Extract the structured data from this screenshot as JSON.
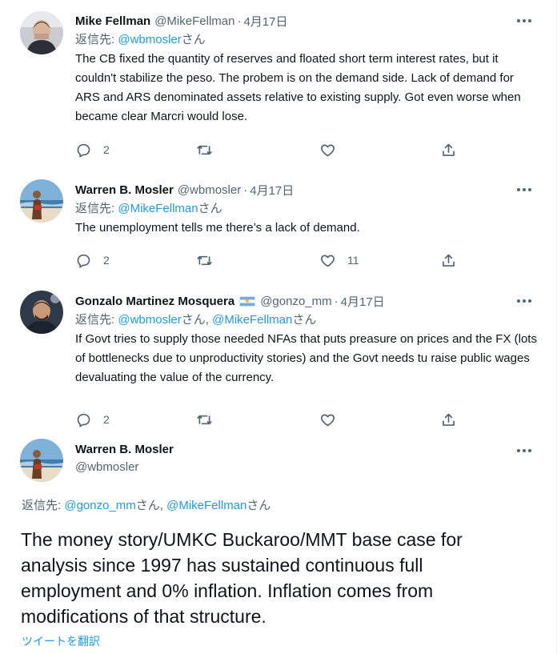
{
  "tweets": [
    {
      "name": "Mike Fellman",
      "handle": "@MikeFellman",
      "sep": "·",
      "date": "4月17日",
      "reply_prefix": "返信先: ",
      "reply_mention": "@wbmosler",
      "reply_suffix": "さん",
      "text": "The CB fixed the quantity of reserves and floated short term interest rates, but it couldn't stabilize the peso. The probem is on the demand side. Lack of demand for ARS and ARS denominated assets relative to existing supply. Got even worse when became clear Marcri would lose.",
      "replies": "2",
      "retweets": "",
      "likes": ""
    },
    {
      "name": "Warren B. Mosler",
      "handle": "@wbmosler",
      "sep": "·",
      "date": "4月17日",
      "reply_prefix": "返信先: ",
      "reply_mention": "@MikeFellman",
      "reply_suffix": "さん",
      "text": "The unemployment tells me there’s a lack of demand.",
      "replies": "2",
      "retweets": "",
      "likes": "11"
    },
    {
      "name": "Gonzalo Martinez Mosquera",
      "handle": "@gonzo_mm",
      "sep": "·",
      "date": "4月17日",
      "reply_prefix": "返信先: ",
      "reply_mention": "@wbmosler",
      "reply_mid": "さん, ",
      "reply_mention2": "@MikeFellman",
      "reply_suffix": "さん",
      "text": "If Govt tries to supply those needed NFAs that puts preasure on prices and the FX (lots of bottlenecks due to unproductivity stories) and the Govt needs tu raise public wages devaluating the value of the currency.",
      "replies": "2",
      "retweets": "",
      "likes": ""
    }
  ],
  "focus": {
    "name": "Warren B. Mosler",
    "handle": "@wbmosler",
    "reply_prefix": "返信先: ",
    "reply_mention": "@gonzo_mm",
    "reply_mid": "さん, ",
    "reply_mention2": "@MikeFellman",
    "reply_suffix": "さん",
    "text": "The money story/UMKC Buckaroo/MMT base case for analysis since 1997 has sustained continuous full employment and 0% inflation. Inflation comes from modifications of that structure.",
    "translate": "ツイートを翻訳"
  },
  "colors": {
    "link": "#1d9bf0",
    "secondary_text": "#536471",
    "primary_text": "#0f1419"
  },
  "icons": {
    "reply": "reply-icon",
    "retweet": "retweet-icon",
    "like": "heart-icon",
    "share": "share-icon",
    "more": "more-icon"
  }
}
